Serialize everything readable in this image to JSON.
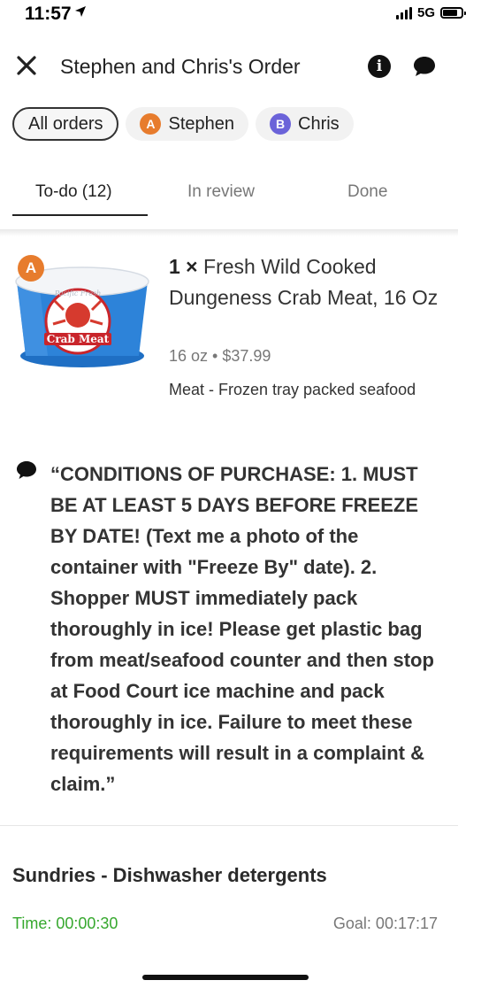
{
  "status_bar": {
    "time": "11:57",
    "network": "5G"
  },
  "header": {
    "title": "Stephen and Chris's Order"
  },
  "filters": [
    {
      "label": "All orders",
      "active": true
    },
    {
      "avatar": "A",
      "label": "Stephen",
      "color": "#E77C2D"
    },
    {
      "avatar": "B",
      "label": "Chris",
      "color": "#6B63D9"
    }
  ],
  "tabs": [
    {
      "label": "To-do (12)",
      "active": true
    },
    {
      "label": "In review"
    },
    {
      "label": "Done"
    }
  ],
  "item": {
    "owner_badge": "A",
    "quantity": "1 ×",
    "name": "Fresh Wild Cooked Dungeness Crab Meat, 16 Oz",
    "meta": "16 oz • $37.99",
    "category": "Meat - Frozen tray packed seafood",
    "image_label": "Crab Meat",
    "image_brand": "Pacific Fresh"
  },
  "note": "“CONDITIONS OF PURCHASE: 1. MUST BE AT LEAST 5 DAYS BEFORE FREEZE BY DATE! (Text me a photo of the container with \"Freeze By\" date). 2. Shopper MUST immediately pack thoroughly in ice! Please get plastic bag from meat/seafood counter and then stop at Food Court ice machine and pack thoroughly in ice.  Failure to meet these requirements will result in a complaint & claim.”",
  "next_section": {
    "title": "Sundries - Dishwasher detergents",
    "timer": "Time: 00:00:30",
    "goal": "Goal: 00:17:17"
  },
  "colors": {
    "accent_green": "#36A82E",
    "stephen": "#E77C2D",
    "chris": "#6B63D9"
  }
}
